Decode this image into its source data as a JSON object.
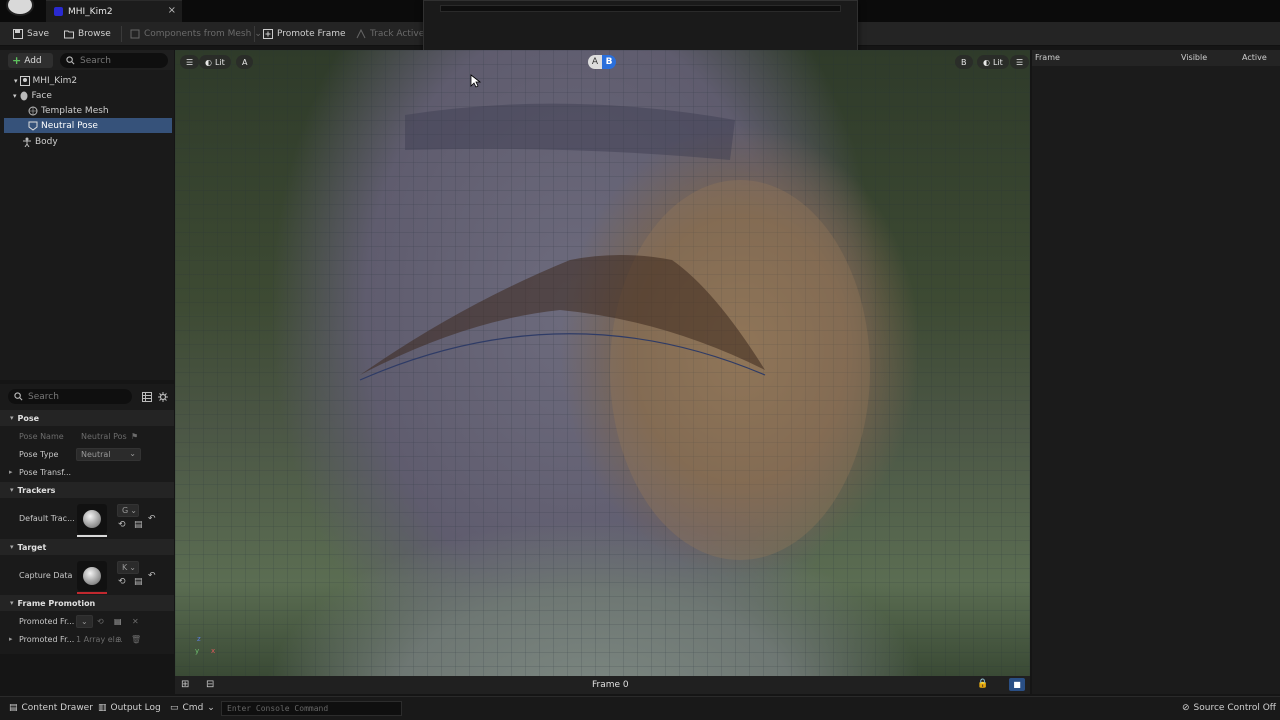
{
  "tab": {
    "title": "MHI_Kim2",
    "close": "×"
  },
  "toolbar": {
    "save": "Save",
    "browse": "Browse",
    "components_from_mesh": "Components from Mesh",
    "promote_frame": "Promote Frame",
    "track_active": "Track Active I"
  },
  "outliner": {
    "add": "Add",
    "search_placeholder": "Search",
    "items": [
      {
        "label": "MHI_Kim2",
        "icon": "mesh-icon"
      },
      {
        "label": "Face",
        "icon": "face-icon"
      },
      {
        "label": "Template Mesh",
        "icon": "mesh-icon"
      },
      {
        "label": "Neutral Pose",
        "icon": "pose-icon",
        "selected": true
      },
      {
        "label": "Body",
        "icon": "body-icon"
      }
    ]
  },
  "details": {
    "search_placeholder": "Search",
    "pose": {
      "title": "Pose",
      "pose_name_label": "Pose Name",
      "pose_name_value": "Neutral Pos",
      "pose_type_label": "Pose Type",
      "pose_type_value": "Neutral",
      "pose_transform_label": "Pose Transf..."
    },
    "trackers": {
      "title": "Trackers",
      "default_tracker_label": "Default Trac...",
      "default_tracker_combo": "G"
    },
    "target": {
      "title": "Target",
      "capture_data_label": "Capture Data",
      "capture_data_combo": "K"
    },
    "frame_promotion": {
      "title": "Frame Promotion",
      "promoted_frames_label": "Promoted Fr...",
      "promoted_frames2_label": "Promoted Fr...",
      "promoted_frames2_value": "1 Array el..."
    }
  },
  "viewport": {
    "lit_left": "Lit",
    "cam_left": "A",
    "ab_a": "A",
    "ab_b": "B",
    "cam_right": "B",
    "lit_right": "Lit",
    "frame_label": "Frame 0",
    "axis_z": "z",
    "axis_y": "y",
    "axis_x": "x"
  },
  "right_panel": {
    "columns": [
      "Frame",
      "Visible",
      "Active"
    ]
  },
  "statusbar": {
    "content_drawer": "Content Drawer",
    "output_log": "Output Log",
    "cmd": "Cmd",
    "console_placeholder": "Enter Console Command",
    "source_control": "Source Control Off"
  }
}
